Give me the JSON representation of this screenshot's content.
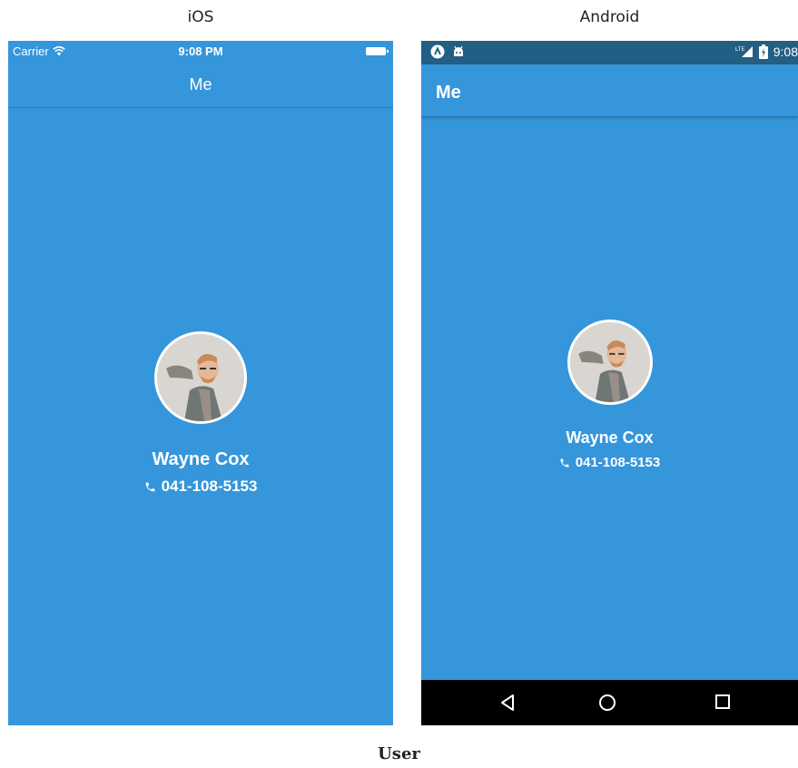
{
  "headings": {
    "ios": "iOS",
    "android": "Android"
  },
  "ios": {
    "status": {
      "carrier": "Carrier",
      "time": "9:08 PM"
    },
    "nav_title": "Me",
    "profile": {
      "name": "Wayne Cox",
      "phone": "041-108-5153"
    }
  },
  "android": {
    "status": {
      "time": "9:08",
      "network": "LTE"
    },
    "app_title": "Me",
    "profile": {
      "name": "Wayne Cox",
      "phone": "041-108-5153"
    }
  },
  "caption": "User",
  "colors": {
    "screen_bg": "#3596db",
    "android_status_bg": "#235e85",
    "android_nav_bg": "#000000",
    "text": "#ffffff"
  },
  "icons": [
    "wifi-icon",
    "battery-icon",
    "phone-icon",
    "avatar",
    "back-icon",
    "home-icon",
    "recents-icon",
    "signal-icon",
    "app-icon",
    "android-icon"
  ]
}
